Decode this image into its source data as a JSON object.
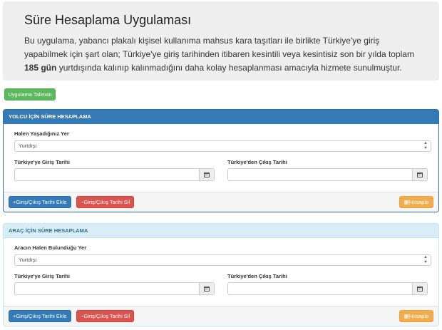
{
  "jumbotron": {
    "title": "Süre Hesaplama Uygulaması",
    "text_before": "Bu uygulama, yabancı plakalı kişisel kullanıma mahsus kara taşıtları ile birlikte Türkiye'ye giriş yapabilmek için şart olan; Türkiye'ye giriş tarihinden itibaren kesintili veya kesintisiz son bir yılda toplam ",
    "text_bold": "185 gün",
    "text_after": " yurtdışında kalınıp kalınmadığını daha kolay hesaplanması amacıyla hizmete sunulmuştur."
  },
  "guide_button": "Uygulama Talimatı",
  "passenger_panel": {
    "heading": "YOLCU İÇİN SÜRE HESAPLAMA",
    "location_label": "Halen Yaşadığınız Yer",
    "location_value": "Yurtdışı",
    "entry_label": "Türkiye'ye Giriş Tarihi",
    "exit_label": "Türkiye'den Çıkış Tarihi",
    "add_button": "+Giriş/Çıkış Tarihi Ekle",
    "remove_button": "−Giriş/Çıkış Tarihi Sil",
    "calc_button": "Hesapla"
  },
  "vehicle_panel": {
    "heading": "ARAÇ İÇİN SÜRE HESAPLAMA",
    "location_label": "Aracın Halen Bulunduğu Yer",
    "location_value": "Yurtdışı",
    "entry_label": "Türkiye'ye Giriş Tarihi",
    "exit_label": "Türkiye'den Çıkış Tarihi",
    "add_button": "+Giriş/Çıkış Tarihi Ekle",
    "remove_button": "−Giriş/Çıkış Tarihi Sil",
    "calc_button": "Hesapla"
  },
  "icons": {
    "calendar": "calendar-icon",
    "select_caret": "⇕",
    "calc": "calculator-icon"
  },
  "colors": {
    "primary": "#337ab7",
    "success": "#5cb85c",
    "danger": "#d9534f",
    "warning": "#f0ad4e",
    "info_bg": "#d9edf7"
  }
}
